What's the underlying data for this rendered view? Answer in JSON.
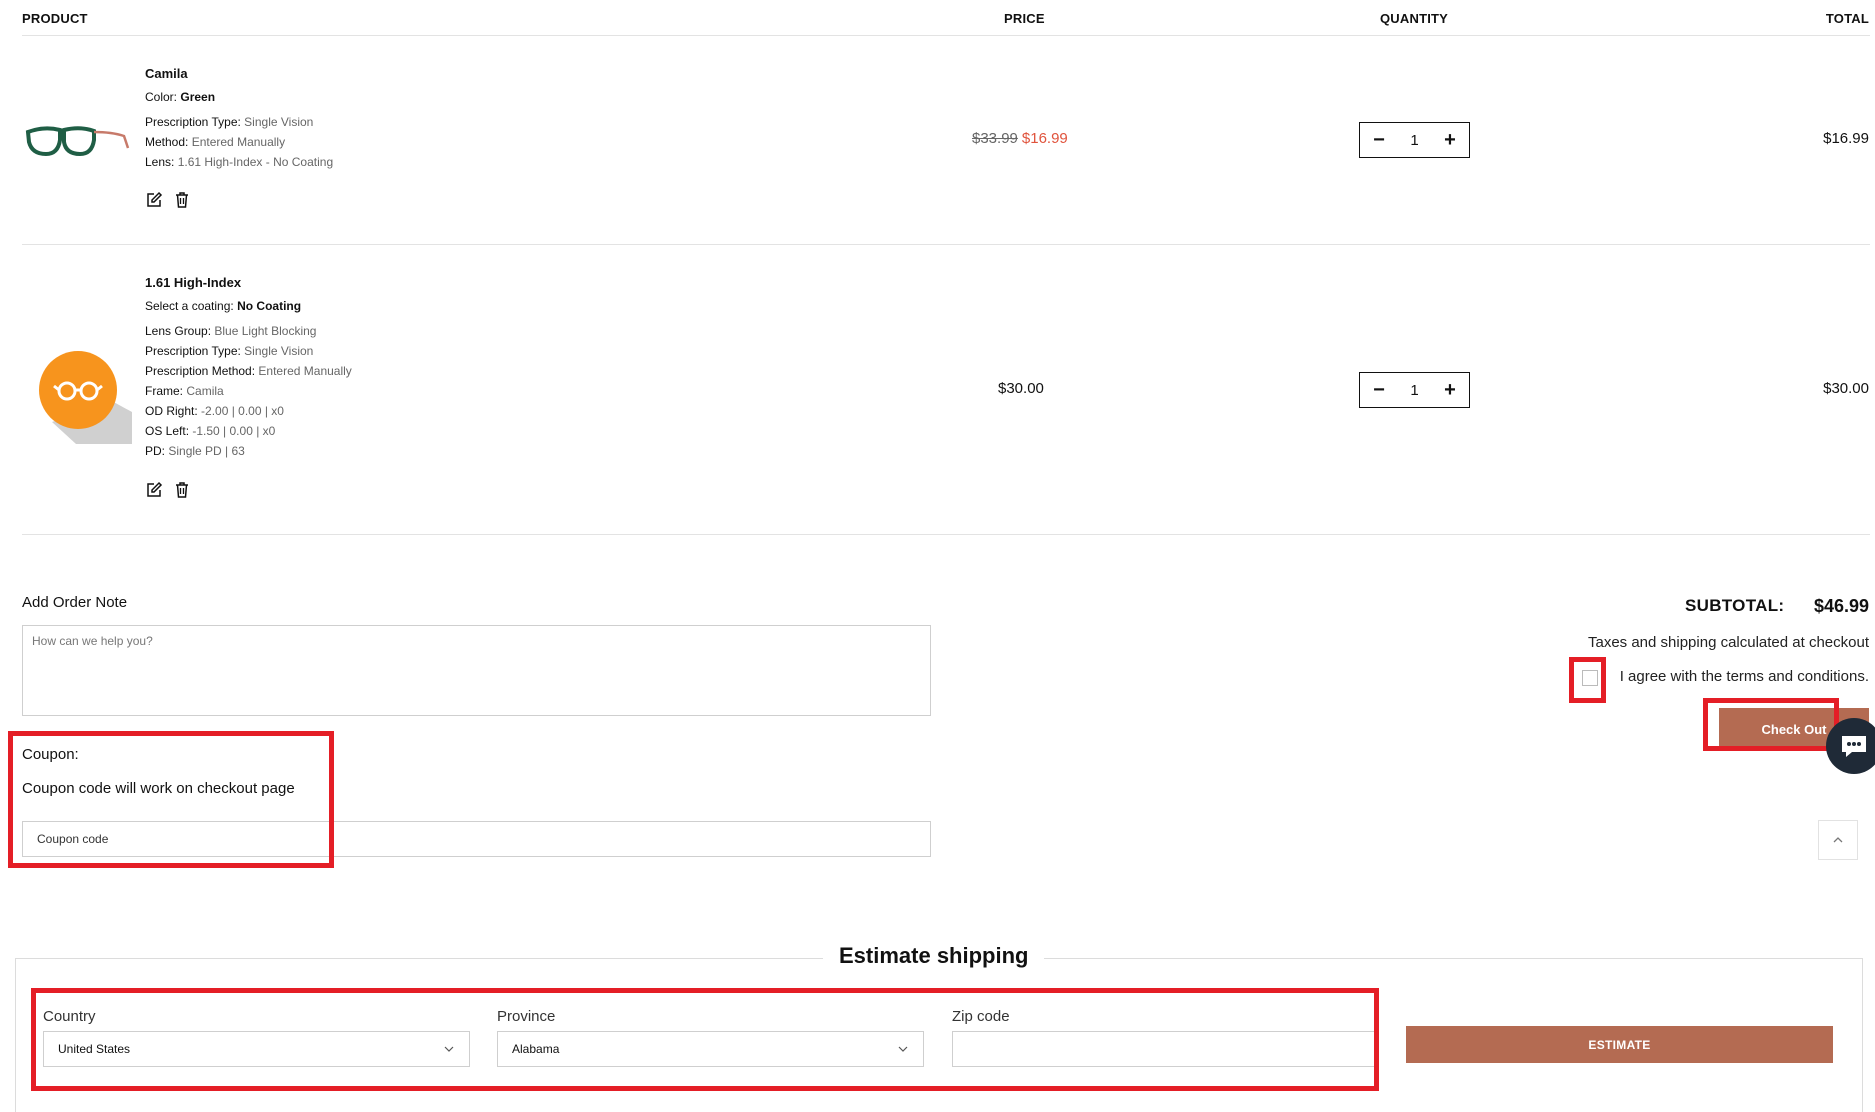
{
  "table": {
    "headers": {
      "product": "PRODUCT",
      "price": "PRICE",
      "quantity": "QUANTITY",
      "total": "TOTAL"
    }
  },
  "items": [
    {
      "name": "Camila",
      "image_icon": "green-eyeglasses-image",
      "attributes": [
        {
          "key": "Color:",
          "value": "Green",
          "bold": true
        },
        {
          "key": "Prescription Type:",
          "value": "Single Vision"
        },
        {
          "key": "Method:",
          "value": "Entered Manually"
        },
        {
          "key": "Lens:",
          "value": "1.61 High-Index - No Coating"
        }
      ],
      "price_old": "$33.99",
      "price_new": "$16.99",
      "quantity": "1",
      "total": "$16.99"
    },
    {
      "name": "1.61 High-Index",
      "image_icon": "orange-glasses-icon",
      "attributes": [
        {
          "key": "Select a coating:",
          "value": "No Coating",
          "bold": true
        },
        {
          "key": "Lens Group:",
          "value": "Blue Light Blocking"
        },
        {
          "key": "Prescription Type:",
          "value": "Single Vision"
        },
        {
          "key": "Prescription Method:",
          "value": "Entered Manually"
        },
        {
          "key": "Frame:",
          "value": "Camila"
        },
        {
          "key": "OD Right:",
          "value": "-2.00 | 0.00 | x0"
        },
        {
          "key": "OS Left:",
          "value": "-1.50 | 0.00 | x0"
        },
        {
          "key": "PD:",
          "value": "Single PD | 63"
        }
      ],
      "price": "$30.00",
      "quantity": "1",
      "total": "$30.00"
    }
  ],
  "order_note": {
    "label": "Add Order Note",
    "placeholder": "How can we help you?"
  },
  "coupon": {
    "label": "Coupon:",
    "hint": "Coupon code will work on checkout page",
    "placeholder": "Coupon code"
  },
  "summary": {
    "subtotal_label": "SUBTOTAL:",
    "subtotal_value": "$46.99",
    "tax_note": "Taxes and shipping calculated at checkout",
    "terms": "I agree with the terms and conditions.",
    "checkout_label": "Check Out"
  },
  "shipping": {
    "title": "Estimate shipping",
    "country_label": "Country",
    "country_value": "United States",
    "province_label": "Province",
    "province_value": "Alabama",
    "zip_label": "Zip code",
    "zip_value": "",
    "estimate_label": "ESTIMATE"
  },
  "colors": {
    "accent": "#b46b52",
    "sale": "#e0533c",
    "annotation": "#e41e26"
  }
}
